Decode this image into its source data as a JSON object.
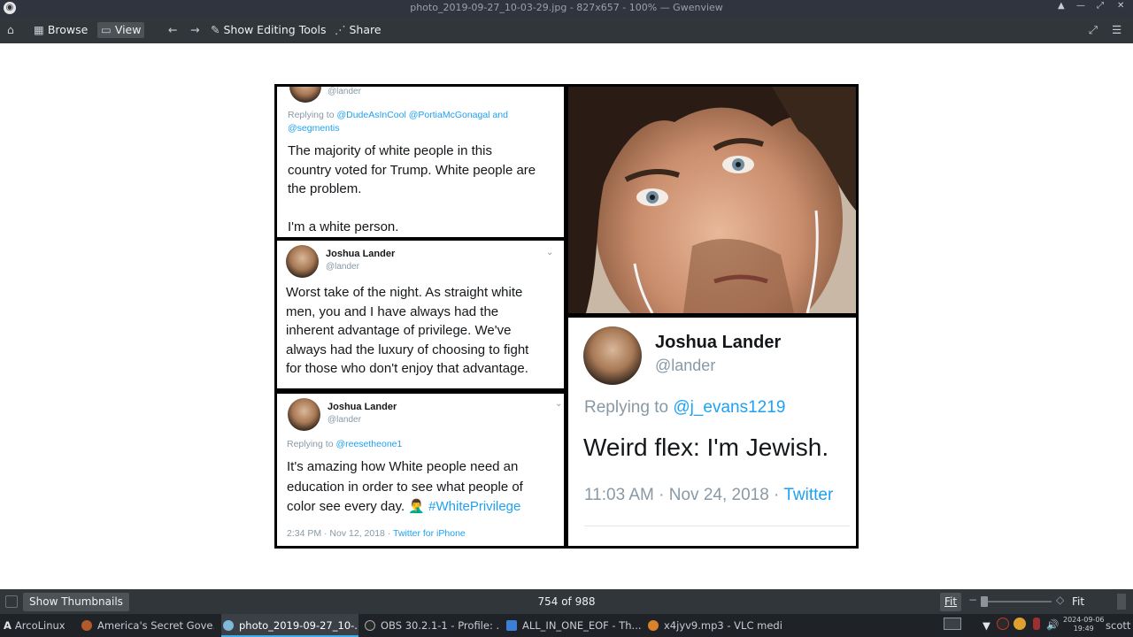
{
  "window": {
    "title": "photo_2019-09-27_10-03-29.jpg - 827x657 - 100% — Gwenview"
  },
  "toolbar": {
    "browse": "Browse",
    "view": "View",
    "show_editing_tools": "Show Editing Tools",
    "share": "Share"
  },
  "photo": {
    "tweet1": {
      "handle": "@lander",
      "replying_prefix": "Replying to ",
      "replying_to": "@DudeAsInCool @PortiaMcGonagal and",
      "replying_to2": "@segmentis",
      "body": [
        "The majority of white people in this",
        "country voted for Trump. White people are",
        "the problem.",
        "",
        "I'm a white person."
      ]
    },
    "tweet2": {
      "name": "Joshua Lander",
      "handle": "@lander",
      "body": [
        "Worst take of the night. As straight white",
        "men, you and I have always had the",
        "inherent advantage of privilege. We've",
        "always had the luxury of choosing to fight",
        "for those who don't enjoy that advantage."
      ]
    },
    "tweet3": {
      "name": "Joshua Lander",
      "handle": "@lander",
      "replying_prefix": "Replying to ",
      "replying_to": "@reesetheone1",
      "body1": "It's amazing how White people need an",
      "body2": "education in order to see what people of",
      "body3_prefix": "color see every day. 🤦‍♂️ ",
      "hashtag": "#WhitePrivilege",
      "time": "2:34 PM · Nov 12, 2018 · ",
      "source": "Twitter for iPhone"
    },
    "tweet4": {
      "name": "Joshua Lander",
      "handle": "@lander",
      "replying_prefix": "Replying to ",
      "replying_to": "@j_evans1219",
      "body": "Weird flex: I'm Jewish.",
      "time": "11:03 AM · Nov 24, 2018 · ",
      "source": "Twitter"
    }
  },
  "statusbar": {
    "show_thumbnails": "Show Thumbnails",
    "counter": "754 of 988",
    "fit_left": "Fit",
    "fit_right": "Fit"
  },
  "taskbar": {
    "start": "ArcoLinux",
    "tasks": [
      "America's Secret Gove...",
      "photo_2019-09-27_10-...",
      "OBS 30.2.1-1 - Profile: ...",
      "ALL_IN_ONE_EOF - Th...",
      "x4jyv9.mp3 - VLC medi..."
    ],
    "date": "2024-09-06",
    "time": "19:49",
    "user": "scott"
  }
}
